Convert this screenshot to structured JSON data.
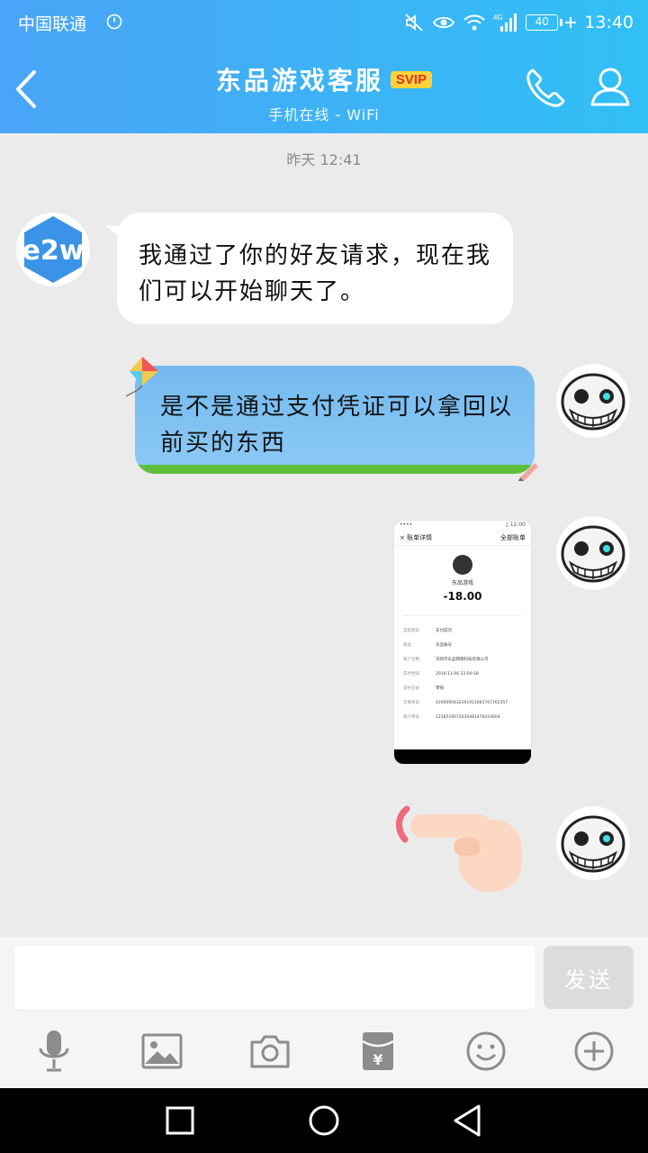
{
  "status_bar": {
    "carrier": "中国联通",
    "battery": "40",
    "network": "4G",
    "time": "13:40"
  },
  "header": {
    "title": "东品游戏客服",
    "badge": "SVIP",
    "subtitle": "手机在线 - WiFi"
  },
  "chat": {
    "timestamp": "昨天 12:41",
    "messages": [
      {
        "side": "left",
        "text": "我通过了你的好友请求，现在我们可以开始聊天了。"
      },
      {
        "side": "right",
        "text": "是不是通过支付凭证可以拿回以前买的东西"
      },
      {
        "side": "right",
        "type": "image",
        "screenshot": {
          "header_left": "账单详情",
          "header_right": "全部账单",
          "merchant": "东品游戏",
          "amount": "-18.00",
          "rows": [
            {
              "k": "当前状态",
              "v": "支付成功"
            },
            {
              "k": "商品",
              "v": "东品账号"
            },
            {
              "k": "商户全称",
              "v": "深圳市东品网络科技有限公司"
            },
            {
              "k": "支付时间",
              "v": "2019-11-06 22:00:18"
            },
            {
              "k": "支付方式",
              "v": "零钱"
            },
            {
              "k": "交易单号",
              "v": "4200000432201911065767762357"
            },
            {
              "k": "商户单号",
              "v": "1238519072030481476419004"
            }
          ]
        }
      },
      {
        "side": "right",
        "type": "sticker",
        "sticker": "pointing-hand"
      }
    ]
  },
  "input": {
    "placeholder": "",
    "send_label": "发送"
  },
  "toolbar": {
    "items": [
      "microphone-icon",
      "image-icon",
      "camera-icon",
      "red-packet-icon",
      "emoji-icon",
      "plus-icon"
    ]
  },
  "colors": {
    "header_start": "#4aa4f7",
    "header_end": "#31c0f5",
    "bubble_right": "#7fc0f2",
    "svip_bg": "#ffd23c"
  }
}
